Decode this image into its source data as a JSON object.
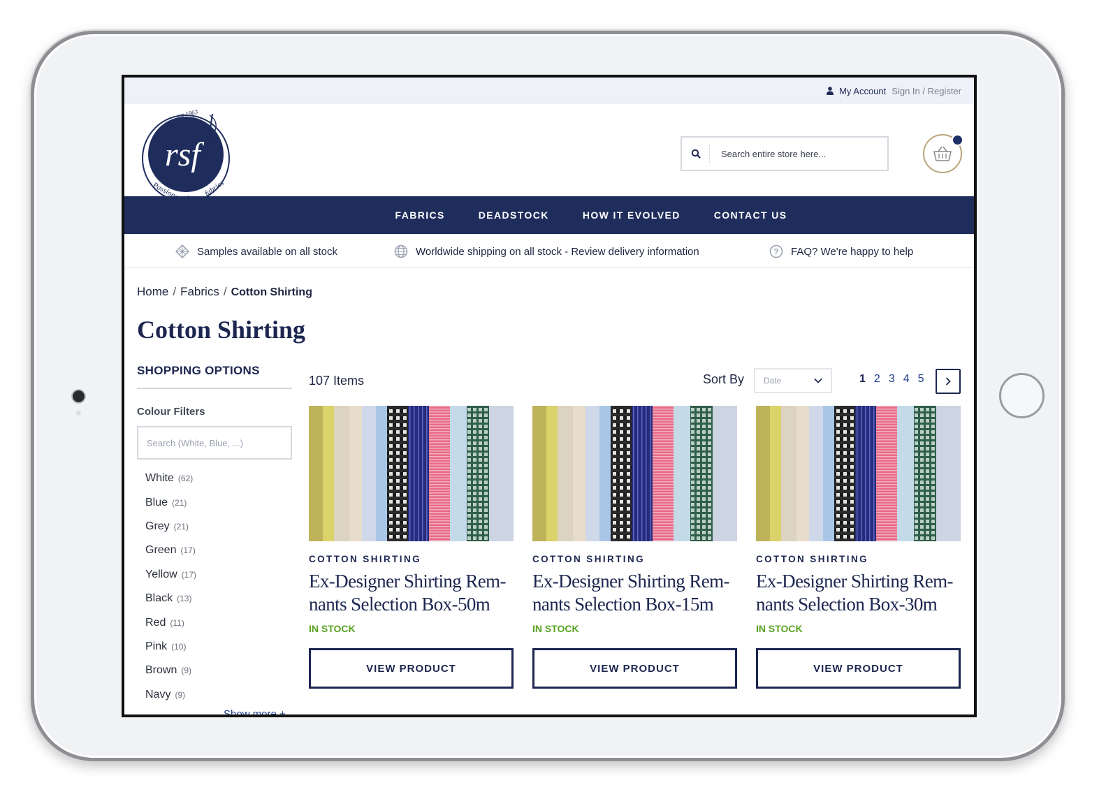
{
  "topbar": {
    "my_account": "My Account",
    "sign_in": "Sign In / Register"
  },
  "logo": {
    "est": "est 1963",
    "monogram": "rsf",
    "tagline": "Passionate about fabrics"
  },
  "search": {
    "placeholder": "Search entire store here..."
  },
  "nav": [
    "FABRICS",
    "DEADSTOCK",
    "HOW IT EVOLVED",
    "CONTACT US"
  ],
  "usp": {
    "samples": "Samples available on all stock",
    "shipping": "Worldwide shipping on all stock - Review delivery information",
    "faq": "FAQ? We're happy to help"
  },
  "breadcrumb": {
    "home": "Home",
    "fabrics": "Fabrics",
    "current": "Cotton Shirting"
  },
  "page_title": "Cotton Shirting",
  "sidebar": {
    "title": "SHOPPING OPTIONS",
    "colour_filters": "Colour Filters",
    "search_placeholder": "Search (White, Blue, ...)",
    "colours": [
      {
        "name": "White",
        "count": "(62)"
      },
      {
        "name": "Blue",
        "count": "(21)"
      },
      {
        "name": "Grey",
        "count": "(21)"
      },
      {
        "name": "Green",
        "count": "(17)"
      },
      {
        "name": "Yellow",
        "count": "(17)"
      },
      {
        "name": "Black",
        "count": "(13)"
      },
      {
        "name": "Red",
        "count": "(11)"
      },
      {
        "name": "Pink",
        "count": "(10)"
      },
      {
        "name": "Brown",
        "count": "(9)"
      },
      {
        "name": "Navy",
        "count": "(9)"
      }
    ],
    "show_more": "Show more +"
  },
  "toolbar": {
    "items": "107 Items",
    "sort_by": "Sort By",
    "sort_value": "Date",
    "pages": [
      "1",
      "2",
      "3",
      "4",
      "5"
    ]
  },
  "products": [
    {
      "category": "COTTON SHIRTING",
      "name": "Ex-Designer Shirting Rem-nants Selection Box-50m",
      "stock": "IN STOCK",
      "button": "VIEW PRODUCT"
    },
    {
      "category": "COTTON SHIRTING",
      "name": "Ex-Designer Shirting Rem-nants Selection Box-15m",
      "stock": "IN STOCK",
      "button": "VIEW PRODUCT"
    },
    {
      "category": "COTTON SHIRTING",
      "name": "Ex-Designer Shirting Rem-nants Selection Box-30m",
      "stock": "IN STOCK",
      "button": "VIEW PRODUCT"
    }
  ],
  "colors": {
    "brand_navy": "#1f2d5c",
    "stock_green": "#58a322"
  }
}
